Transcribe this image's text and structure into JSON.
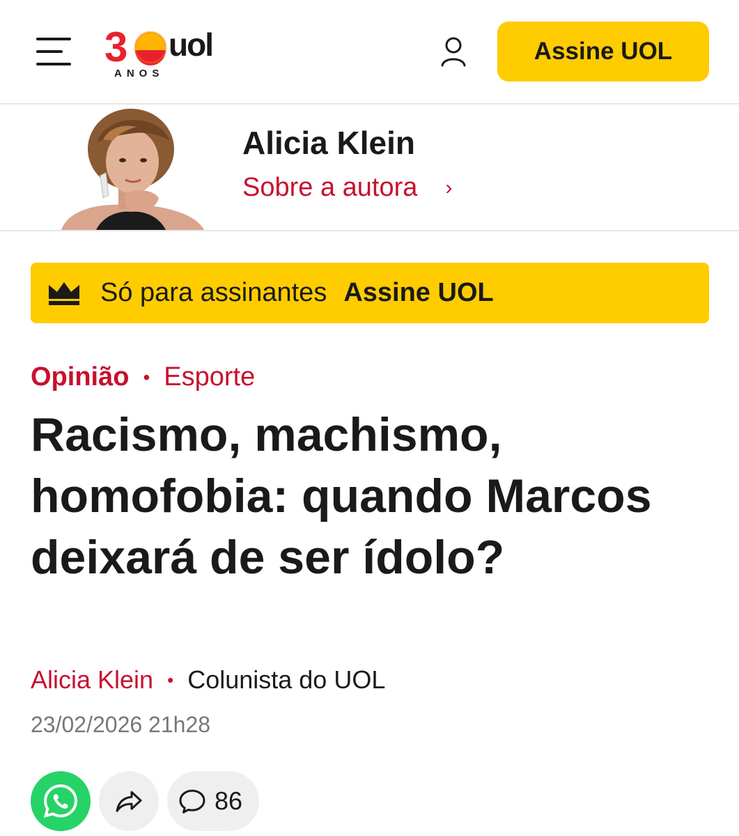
{
  "header": {
    "logo_number": "30",
    "logo_brand": "uol",
    "logo_sub": "ANOS",
    "subscribe_label": "Assine UOL",
    "icons": {
      "menu": "hamburger-menu-icon",
      "user": "user-icon"
    }
  },
  "author_card": {
    "name": "Alicia Klein",
    "link_label": "Sobre a autora",
    "chevron": "›"
  },
  "paywall": {
    "icon": "crown-icon",
    "text": "Só para assinantes",
    "link_label": "Assine UOL"
  },
  "article": {
    "section": "Opinião",
    "separator": "•",
    "category": "Esporte",
    "headline": "Racismo, machismo, homofobia: quando Marcos deixará de ser ídolo?",
    "author": "Alicia Klein",
    "author_role": "Colunista do UOL",
    "date": "23/02/2026 21h28"
  },
  "actions": {
    "whatsapp_icon": "whatsapp-icon",
    "share_icon": "share-icon",
    "comment_icon": "comment-icon",
    "comment_count": "86"
  },
  "colors": {
    "brand_yellow": "#ffcc00",
    "accent_red": "#c8102e",
    "whatsapp_green": "#25d366",
    "text_dark": "#1a1a1a",
    "muted": "#777777"
  }
}
